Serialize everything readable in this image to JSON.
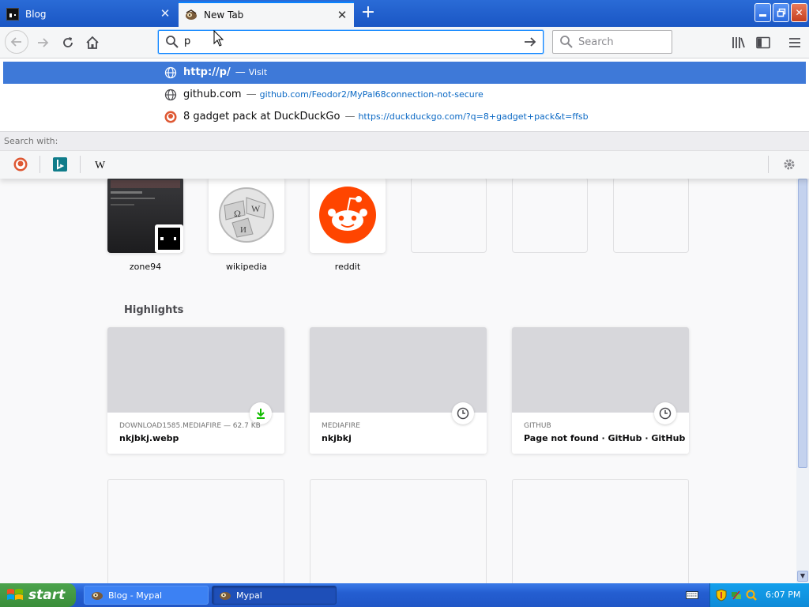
{
  "tabs": [
    {
      "title": "Blog",
      "active": false
    },
    {
      "title": "New Tab",
      "active": true
    }
  ],
  "urlbar": {
    "value": "p"
  },
  "searchbar": {
    "placeholder": "Search"
  },
  "suggestions": [
    {
      "title": "http://p/",
      "sep": "—",
      "url": "Visit",
      "icon": "globe-icon"
    },
    {
      "title": "github.com",
      "sep": "—",
      "url": "github.com/Feodor2/MyPal68connection-not-secure",
      "icon": "globe-icon"
    },
    {
      "title": "8 gadget pack at DuckDuckGo",
      "sep": "—",
      "url": "https://duckduckgo.com/?q=8+gadget+pack&t=ffsb",
      "icon": "duckduckgo-icon"
    }
  ],
  "search_with_label": "Search with:",
  "search_engines": [
    "duckduckgo-icon",
    "bing-icon",
    "wikipedia-icon"
  ],
  "top_sites": [
    {
      "label": "zone94"
    },
    {
      "label": "wikipedia"
    },
    {
      "label": "reddit"
    },
    {
      "label": ""
    },
    {
      "label": ""
    },
    {
      "label": ""
    }
  ],
  "highlights": {
    "title": "Highlights",
    "cards": [
      {
        "host": "DOWNLOAD1585.MEDIAFIRE — 62.7 KB",
        "title": "nkjbkj.webp",
        "badge": "download-icon"
      },
      {
        "host": "MEDIAFIRE",
        "title": "nkjbkj",
        "badge": "clock-icon"
      },
      {
        "host": "GITHUB",
        "title": "Page not found · GitHub · GitHub",
        "badge": "clock-icon"
      }
    ]
  },
  "taskbar": {
    "start_label": "start",
    "tasks": [
      {
        "label": "Blog - Mypal"
      },
      {
        "label": "Mypal"
      }
    ],
    "clock": "6:07 PM"
  },
  "colors": {
    "accent": "#0a84ff",
    "selected_suggestion": "#3e79d8",
    "taskbar": "#245ed1",
    "start_button": "#3a8e3a",
    "reddit": "#ff4500"
  }
}
